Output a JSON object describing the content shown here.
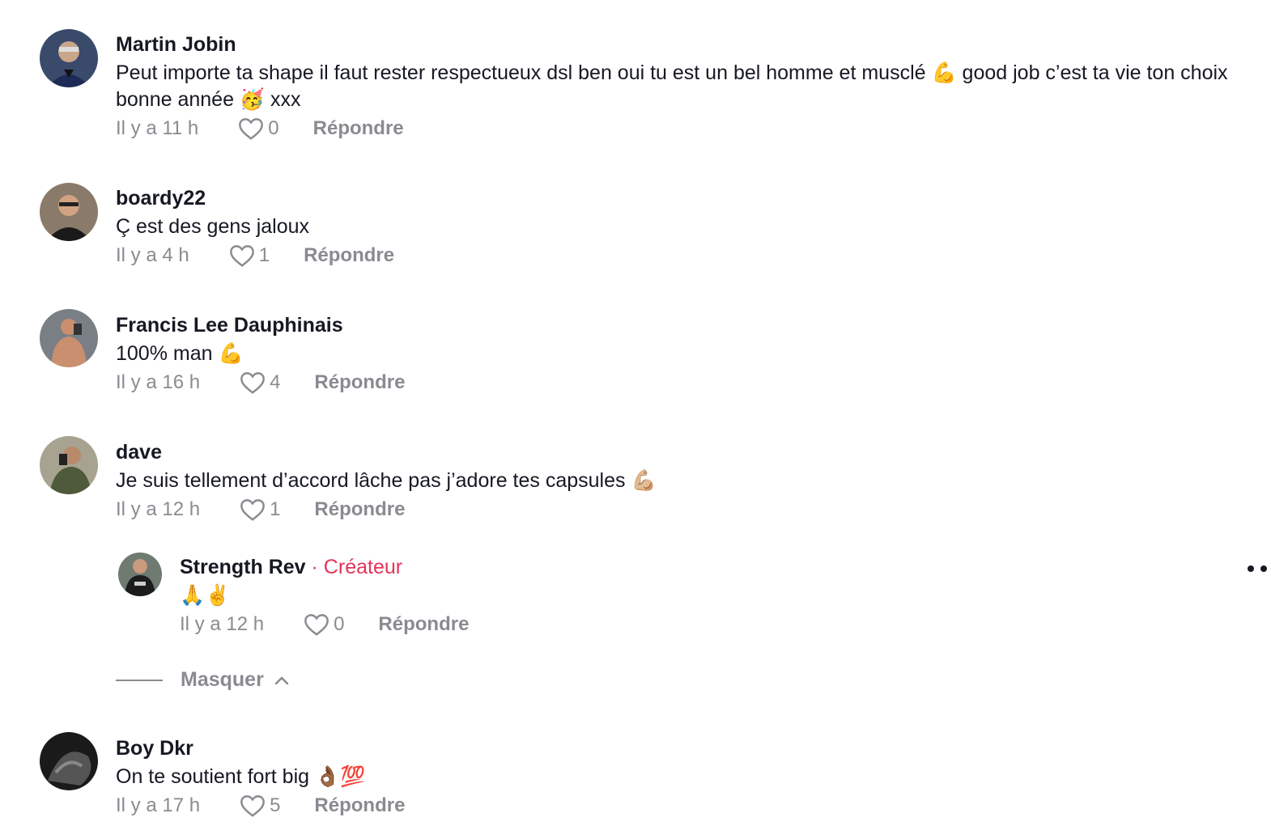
{
  "comments": [
    {
      "username": "Martin Jobin",
      "text": "Peut importe ta shape il faut rester respectueux dsl ben oui tu est un bel homme et musclé 💪 good job c’est ta vie ton choix bonne année 🥳 xxx",
      "time": "Il y a 11 h",
      "likes": "0",
      "reply_label": "Répondre"
    },
    {
      "username": "boardy22",
      "text": "Ç est des gens jaloux",
      "time": "Il y a 4 h",
      "likes": "1",
      "reply_label": "Répondre"
    },
    {
      "username": "Francis Lee Dauphinais",
      "text": "100% man 💪",
      "time": "Il y a 16 h",
      "likes": "4",
      "reply_label": "Répondre"
    },
    {
      "username": "dave",
      "text": "Je suis tellement d’accord lâche pas j’adore tes capsules 💪🏼",
      "time": "Il y a 12 h",
      "likes": "1",
      "reply_label": "Répondre"
    },
    {
      "username": "Boy Dkr",
      "text": "On te soutient fort big 👌🏾💯",
      "time": "Il y a 17 h",
      "likes": "5",
      "reply_label": "Répondre"
    }
  ],
  "reply": {
    "username": "Strength Rev",
    "creator_badge": " · Créateur",
    "text": "🙏✌️",
    "time": "Il y a 12 h",
    "likes": "0",
    "reply_label": "Répondre"
  },
  "hide_label": "Masquer",
  "colors": {
    "text": "#161823",
    "muted": "#8a8b91",
    "creator": "#e4335a"
  },
  "icons": [
    "heart-outline-icon",
    "chevron-up-icon",
    "more-options-icon"
  ]
}
